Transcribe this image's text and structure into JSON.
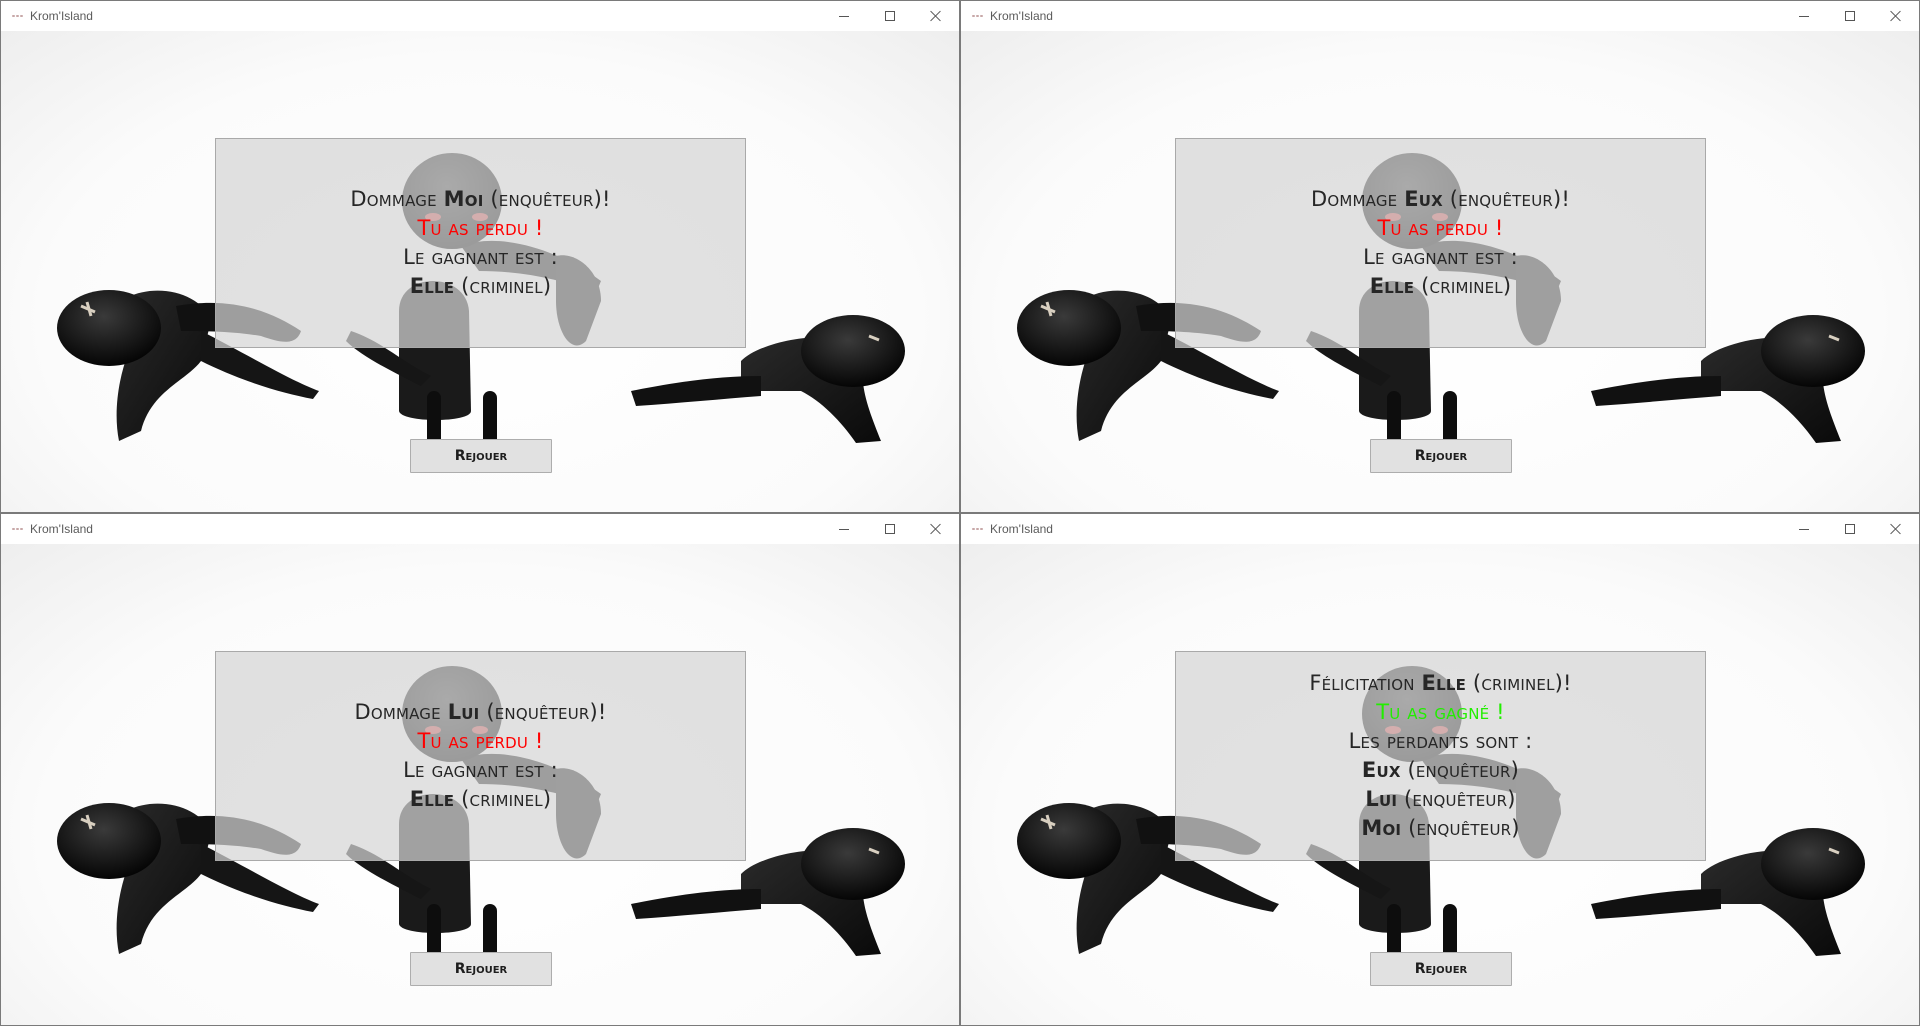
{
  "windows": [
    {
      "title": "Krom'Island",
      "outcome": "lose",
      "message": [
        "Dommage Moi (enquêteur)!",
        "Tu as perdu !",
        "Le gagnant est :",
        "Elle (criminel)"
      ],
      "replay_label": "Rejouer"
    },
    {
      "title": "Krom'Island",
      "outcome": "lose",
      "message": [
        "Dommage Eux (enquêteur)!",
        "Tu as perdu !",
        "Le gagnant est :",
        "Elle (criminel)"
      ],
      "replay_label": "Rejouer"
    },
    {
      "title": "Krom'Island",
      "outcome": "lose",
      "message": [
        "Dommage Lui (enquêteur)!",
        "Tu as perdu !",
        "Le gagnant est :",
        "Elle (criminel)"
      ],
      "replay_label": "Rejouer"
    },
    {
      "title": "Krom'Island",
      "outcome": "win",
      "message": [
        "Félicitation Elle (criminel)!",
        "Tu as gagné !",
        "Les perdants sont :",
        "Eux (enquêteur)",
        "Lui (enquêteur)",
        "Moi (enquêteur)"
      ],
      "replay_label": "Rejouer"
    }
  ],
  "colors": {
    "lose_text": "#ff0000",
    "win_text": "#22ee00",
    "normal_text": "#262626"
  },
  "icons": {
    "app": "krom-island-app-icon",
    "minimize": "minimize-icon",
    "maximize": "maximize-icon",
    "close": "close-icon"
  }
}
